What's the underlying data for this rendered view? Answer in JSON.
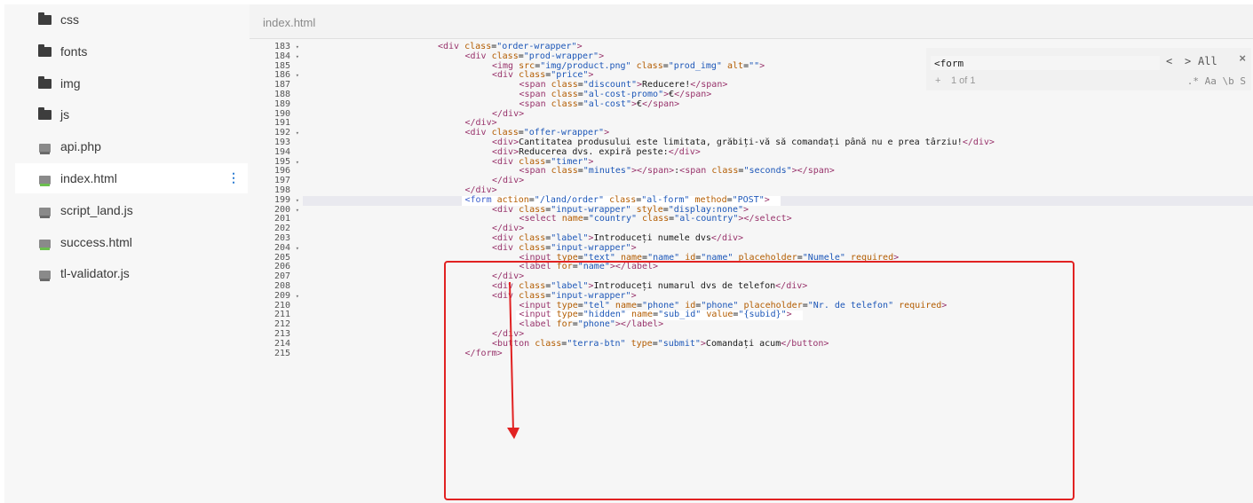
{
  "sidebar": {
    "items": [
      {
        "label": "css",
        "icon": "folder-icon",
        "kind": "folder"
      },
      {
        "label": "fonts",
        "icon": "folder-icon",
        "kind": "folder"
      },
      {
        "label": "img",
        "icon": "folder-icon",
        "kind": "folder"
      },
      {
        "label": "js",
        "icon": "folder-icon",
        "kind": "folder"
      },
      {
        "label": "api.php",
        "icon": "php-file-icon",
        "kind": "file"
      },
      {
        "label": "index.html",
        "icon": "html-file-icon",
        "kind": "file",
        "active": true
      },
      {
        "label": "script_land.js",
        "icon": "js-file-icon",
        "kind": "file"
      },
      {
        "label": "success.html",
        "icon": "html-file-icon",
        "kind": "file"
      },
      {
        "label": "tl-validator.js",
        "icon": "js-file-icon",
        "kind": "file"
      }
    ],
    "more_icon": "kebab-menu-icon"
  },
  "editor": {
    "tab_title": "index.html",
    "search": {
      "value": "<form",
      "prev": "<",
      "next": ">",
      "all": "All",
      "close": "×",
      "plus": "+",
      "match_count": "1 of 1",
      "options": ".* Aa \\b S"
    },
    "line_numbers": [
      "183",
      "184",
      "185",
      "186",
      "187",
      "188",
      "189",
      "190",
      "191",
      "192",
      "193",
      "194",
      "195",
      "196",
      "197",
      "198",
      "199",
      "200",
      "201",
      "202",
      "203",
      "204",
      "205",
      "206",
      "207",
      "208",
      "209",
      "210",
      "211",
      "212",
      "213",
      "214",
      "215"
    ],
    "folds": [
      "183",
      "184",
      "186",
      "192",
      "195",
      "199",
      "200",
      "204",
      "209"
    ],
    "highlighted_line": "199",
    "code": [
      {
        "indent": 4,
        "html": "<span class='t'>&lt;div</span> <span class='a'>class</span>=<span class='v'>\"order-wrapper\"</span><span class='t'>&gt;</span>"
      },
      {
        "indent": 5,
        "html": "<span class='t'>&lt;div</span> <span class='a'>class</span>=<span class='v'>\"prod-wrapper\"</span><span class='t'>&gt;</span>"
      },
      {
        "indent": 6,
        "html": "<span class='t'>&lt;img</span> <span class='a'>src</span>=<span class='v'>\"img/product.png\"</span> <span class='a'>class</span>=<span class='v'>\"prod_img\"</span> <span class='a'>alt</span>=<span class='v'>\"\"</span><span class='t'>&gt;</span>"
      },
      {
        "indent": 6,
        "html": "<span class='t'>&lt;div</span> <span class='a'>class</span>=<span class='v'>\"price\"</span><span class='t'>&gt;</span>"
      },
      {
        "indent": 7,
        "html": "<span class='t'>&lt;span</span> <span class='a'>class</span>=<span class='v'>\"discount\"</span><span class='t'>&gt;</span>Reducere!<span class='t'>&lt;/span&gt;</span>"
      },
      {
        "indent": 7,
        "html": "<span class='t'>&lt;span</span> <span class='a'>class</span>=<span class='v'>\"al-cost-promo\"</span><span class='t'>&gt;</span>€<span class='t'>&lt;/span&gt;</span>"
      },
      {
        "indent": 7,
        "html": "<span class='t'>&lt;span</span> <span class='a'>class</span>=<span class='v'>\"al-cost\"</span><span class='t'>&gt;</span>€<span class='t'>&lt;/span&gt;</span>"
      },
      {
        "indent": 6,
        "html": "<span class='t'>&lt;/div&gt;</span>"
      },
      {
        "indent": 5,
        "html": "<span class='t'>&lt;/div&gt;</span>"
      },
      {
        "indent": 5,
        "html": "<span class='t'>&lt;div</span> <span class='a'>class</span>=<span class='v'>\"offer-wrapper\"</span><span class='t'>&gt;</span>"
      },
      {
        "indent": 6,
        "html": "<span class='t'>&lt;div&gt;</span>Cantitatea produsului este limitata, grăbiți-vă să comandați până nu e prea târziu!<span class='t'>&lt;/div&gt;</span>"
      },
      {
        "indent": 6,
        "html": "<span class='t'>&lt;div&gt;</span>Reducerea dvs. expiră peste:<span class='t'>&lt;/div&gt;</span>"
      },
      {
        "indent": 6,
        "html": "<span class='t'>&lt;div</span> <span class='a'>class</span>=<span class='v'>\"timer\"</span><span class='t'>&gt;</span>"
      },
      {
        "indent": 7,
        "html": "<span class='t'>&lt;span</span> <span class='a'>class</span>=<span class='v'>\"minutes\"</span><span class='t'>&gt;&lt;/span&gt;</span>:<span class='t'>&lt;span</span> <span class='a'>class</span>=<span class='v'>\"seconds\"</span><span class='t'>&gt;&lt;/span&gt;</span>"
      },
      {
        "indent": 6,
        "html": "<span class='t'>&lt;/div&gt;</span>"
      },
      {
        "indent": 5,
        "html": "<span class='t'>&lt;/div&gt;</span>"
      },
      {
        "indent": 5,
        "box": true,
        "html": "<span class='sel-t'>&lt;form</span> <span class='a'>action</span>=<span class='v'>\"/land/order\"</span> <span class='a'>class</span>=<span class='v'>\"al-form\"</span> <span class='a'>method</span>=<span class='v'>\"POST\"</span><span class='t'>&gt;</span>"
      },
      {
        "indent": 6,
        "html": "<span class='t'>&lt;div</span> <span class='a'>class</span>=<span class='v'>\"input-wrapper\"</span> <span class='a'>style</span>=<span class='v'>\"display:none\"</span><span class='t'>&gt;</span>"
      },
      {
        "indent": 7,
        "html": "<span class='t'>&lt;select</span> <span class='a'>name</span>=<span class='v'>\"country\"</span> <span class='a'>class</span>=<span class='v'>\"al-country\"</span><span class='t'>&gt;&lt;/select&gt;</span>"
      },
      {
        "indent": 6,
        "html": "<span class='t'>&lt;/div&gt;</span>"
      },
      {
        "indent": 6,
        "html": "<span class='t'>&lt;div</span> <span class='a'>class</span>=<span class='v'>\"label\"</span><span class='t'>&gt;</span>Introduceți numele dvs<span class='t'>&lt;/div&gt;</span>"
      },
      {
        "indent": 6,
        "html": "<span class='t'>&lt;div</span> <span class='a'>class</span>=<span class='v'>\"input-wrapper\"</span><span class='t'>&gt;</span>"
      },
      {
        "indent": 7,
        "html": "<span class='t'>&lt;input</span> <span class='a'>type</span>=<span class='v'>\"text\"</span> <span class='a'>name</span>=<span class='v'>\"name\"</span> <span class='a'>id</span>=<span class='v'>\"name\"</span> <span class='a'>placeholder</span>=<span class='v'>\"Numele\"</span> <span class='a'>required</span><span class='t'>&gt;</span>"
      },
      {
        "indent": 7,
        "html": "<span class='t'>&lt;label</span> <span class='a'>for</span>=<span class='v'>\"name\"</span><span class='t'>&gt;&lt;/label&gt;</span>"
      },
      {
        "indent": 6,
        "html": "<span class='t'>&lt;/div&gt;</span>"
      },
      {
        "indent": 6,
        "html": "<span class='t'>&lt;div</span> <span class='a'>class</span>=<span class='v'>\"label\"</span><span class='t'>&gt;</span>Introduceți numarul dvs de telefon<span class='t'>&lt;/div&gt;</span>"
      },
      {
        "indent": 6,
        "html": "<span class='t'>&lt;div</span> <span class='a'>class</span>=<span class='v'>\"input-wrapper\"</span><span class='t'>&gt;</span>"
      },
      {
        "indent": 7,
        "html": "<span class='t'>&lt;input</span> <span class='a'>type</span>=<span class='v'>\"tel\"</span> <span class='a'>name</span>=<span class='v'>\"phone\"</span> <span class='a'>id</span>=<span class='v'>\"phone\"</span> <span class='a'>placeholder</span>=<span class='v'>\"Nr. de telefon\"</span> <span class='a'>required</span><span class='t'>&gt;</span>"
      },
      {
        "indent": 7,
        "box": true,
        "html": "<span class='t'>&lt;input</span> <span class='a'>type</span>=<span class='v'>\"hidden\"</span> <span class='a'>name</span>=<span class='v'>\"sub_id\"</span> <span class='a'>value</span>=<span class='v'>\"{subid}\"</span><span class='t'>&gt;</span>"
      },
      {
        "indent": 7,
        "html": "<span class='t'>&lt;label</span> <span class='a'>for</span>=<span class='v'>\"phone\"</span><span class='t'>&gt;&lt;/label&gt;</span>"
      },
      {
        "indent": 6,
        "html": "<span class='t'>&lt;/div&gt;</span>"
      },
      {
        "indent": 6,
        "html": "<span class='t'>&lt;button</span> <span class='a'>class</span>=<span class='v'>\"terra-btn\"</span> <span class='a'>type</span>=<span class='v'>\"submit\"</span><span class='t'>&gt;</span>Comandați acum<span class='t'>&lt;/button&gt;</span>"
      },
      {
        "indent": 5,
        "html": "<span class='t'>&lt;/form&gt;</span>"
      }
    ]
  },
  "annotation": {
    "color": "#e12222"
  }
}
